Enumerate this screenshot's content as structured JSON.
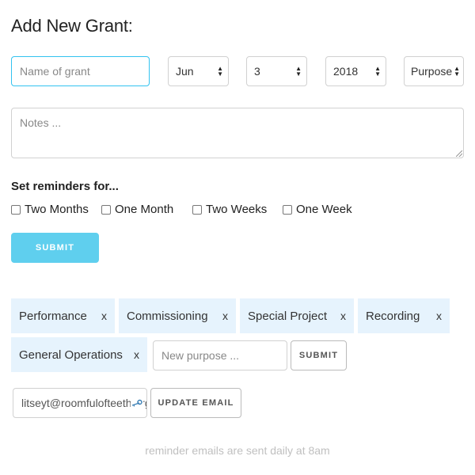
{
  "form": {
    "title": "Add New Grant:",
    "name_placeholder": "Name of grant",
    "month": "Jun",
    "day": "3",
    "year": "2018",
    "purpose": "Purpose",
    "notes_placeholder": "Notes ...",
    "reminders_label": "Set reminders for...",
    "reminders": [
      {
        "label": "Two Months",
        "checked": false
      },
      {
        "label": "One Month",
        "checked": false
      },
      {
        "label": "Two Weeks",
        "checked": false
      },
      {
        "label": "One Week",
        "checked": false
      }
    ],
    "submit_label": "SUBMIT"
  },
  "purposes": {
    "tags": [
      {
        "label": "Performance",
        "remove": "x"
      },
      {
        "label": "Commissioning",
        "remove": "x"
      },
      {
        "label": "Special Project",
        "remove": "x"
      },
      {
        "label": "Recording",
        "remove": "x"
      },
      {
        "label": "General Operations",
        "remove": "x"
      }
    ],
    "new_placeholder": "New purpose ...",
    "submit_label": "SUBMIT"
  },
  "email": {
    "value": "litseyt@roomfulofteeth.org",
    "update_label": "UPDATE EMAIL"
  },
  "footer": {
    "note": "reminder emails are sent daily at 8am"
  },
  "colors": {
    "accent": "#5fcfee",
    "focus": "#33c3f0",
    "tag_bg": "#e6f3fd"
  }
}
